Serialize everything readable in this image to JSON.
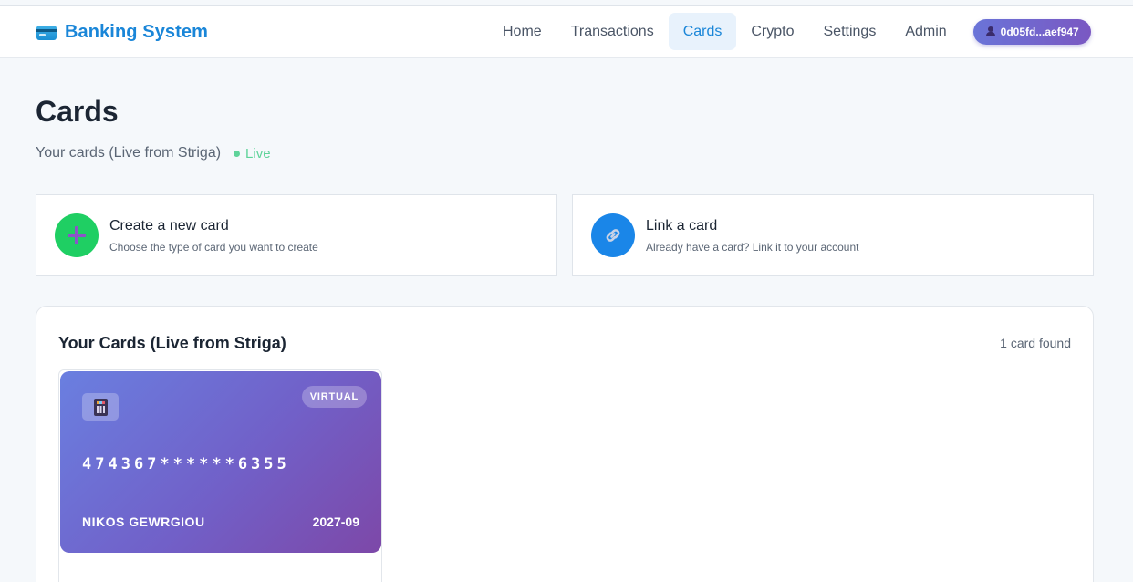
{
  "app": {
    "title": "Banking System"
  },
  "nav": {
    "items": [
      {
        "label": "Home",
        "active": false
      },
      {
        "label": "Transactions",
        "active": false
      },
      {
        "label": "Cards",
        "active": true
      },
      {
        "label": "Crypto",
        "active": false
      },
      {
        "label": "Settings",
        "active": false
      },
      {
        "label": "Admin",
        "active": false
      }
    ],
    "user": "0d05fd...aef947"
  },
  "page": {
    "title": "Cards",
    "subtitle": "Your cards (Live from Striga)",
    "status": "Live"
  },
  "actions": {
    "create": {
      "title": "Create a new card",
      "description": "Choose the type of card you want to create",
      "icon": "plus-icon"
    },
    "link": {
      "title": "Link a card",
      "description": "Already have a card? Link it to your account",
      "icon": "link-icon"
    }
  },
  "cards_panel": {
    "title": "Your Cards (Live from Striga)",
    "count": "1 card found",
    "cards": [
      {
        "type": "VIRTUAL",
        "number": "474367******6355",
        "holder": "NIKOS GEWRGIOU",
        "expiry": "2027-09"
      }
    ]
  },
  "colors": {
    "brand": "#1a86d8",
    "active_nav_bg": "#e8f2fc",
    "live_green": "#5fd39a",
    "create_green": "#1fcf63",
    "link_blue": "#1a86e8",
    "card_gradient_start": "#6a7fe0",
    "card_gradient_end": "#7d48a8"
  }
}
